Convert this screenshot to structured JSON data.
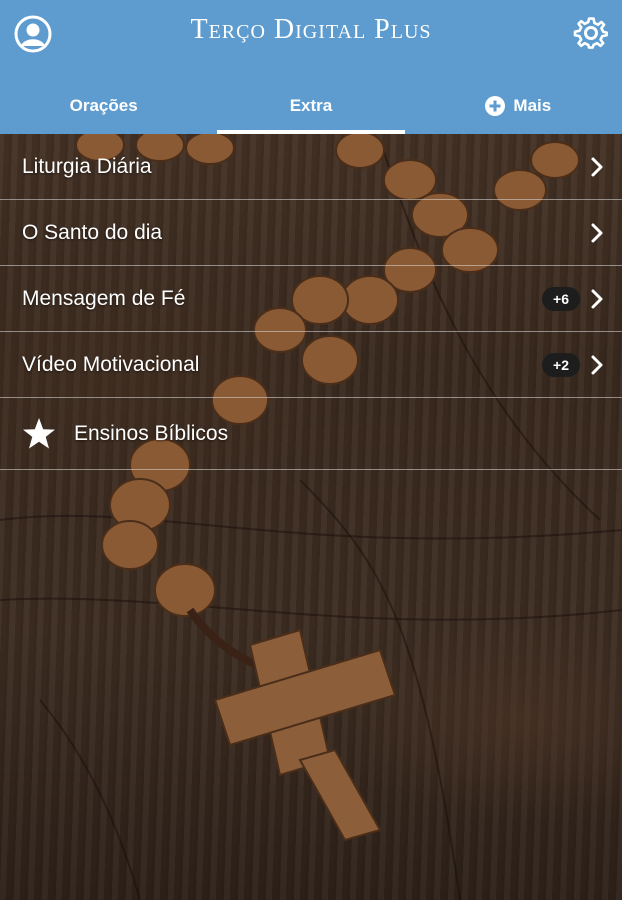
{
  "header": {
    "title": "Terço Digital Plus",
    "background_color": "#5e9ccf"
  },
  "tabs": [
    {
      "label": "Orações",
      "active": false
    },
    {
      "label": "Extra",
      "active": true
    },
    {
      "label": "Mais",
      "active": false,
      "icon": "plus-circle-icon"
    }
  ],
  "menu": {
    "items": [
      {
        "label": "Liturgia Diária",
        "badge": ""
      },
      {
        "label": "O Santo do dia",
        "badge": ""
      },
      {
        "label": "Mensagem de Fé",
        "badge": "+6"
      },
      {
        "label": "Vídeo Motivacional",
        "badge": "+2"
      },
      {
        "label": "Ensinos Bíblicos",
        "icon": "star-icon"
      }
    ]
  }
}
